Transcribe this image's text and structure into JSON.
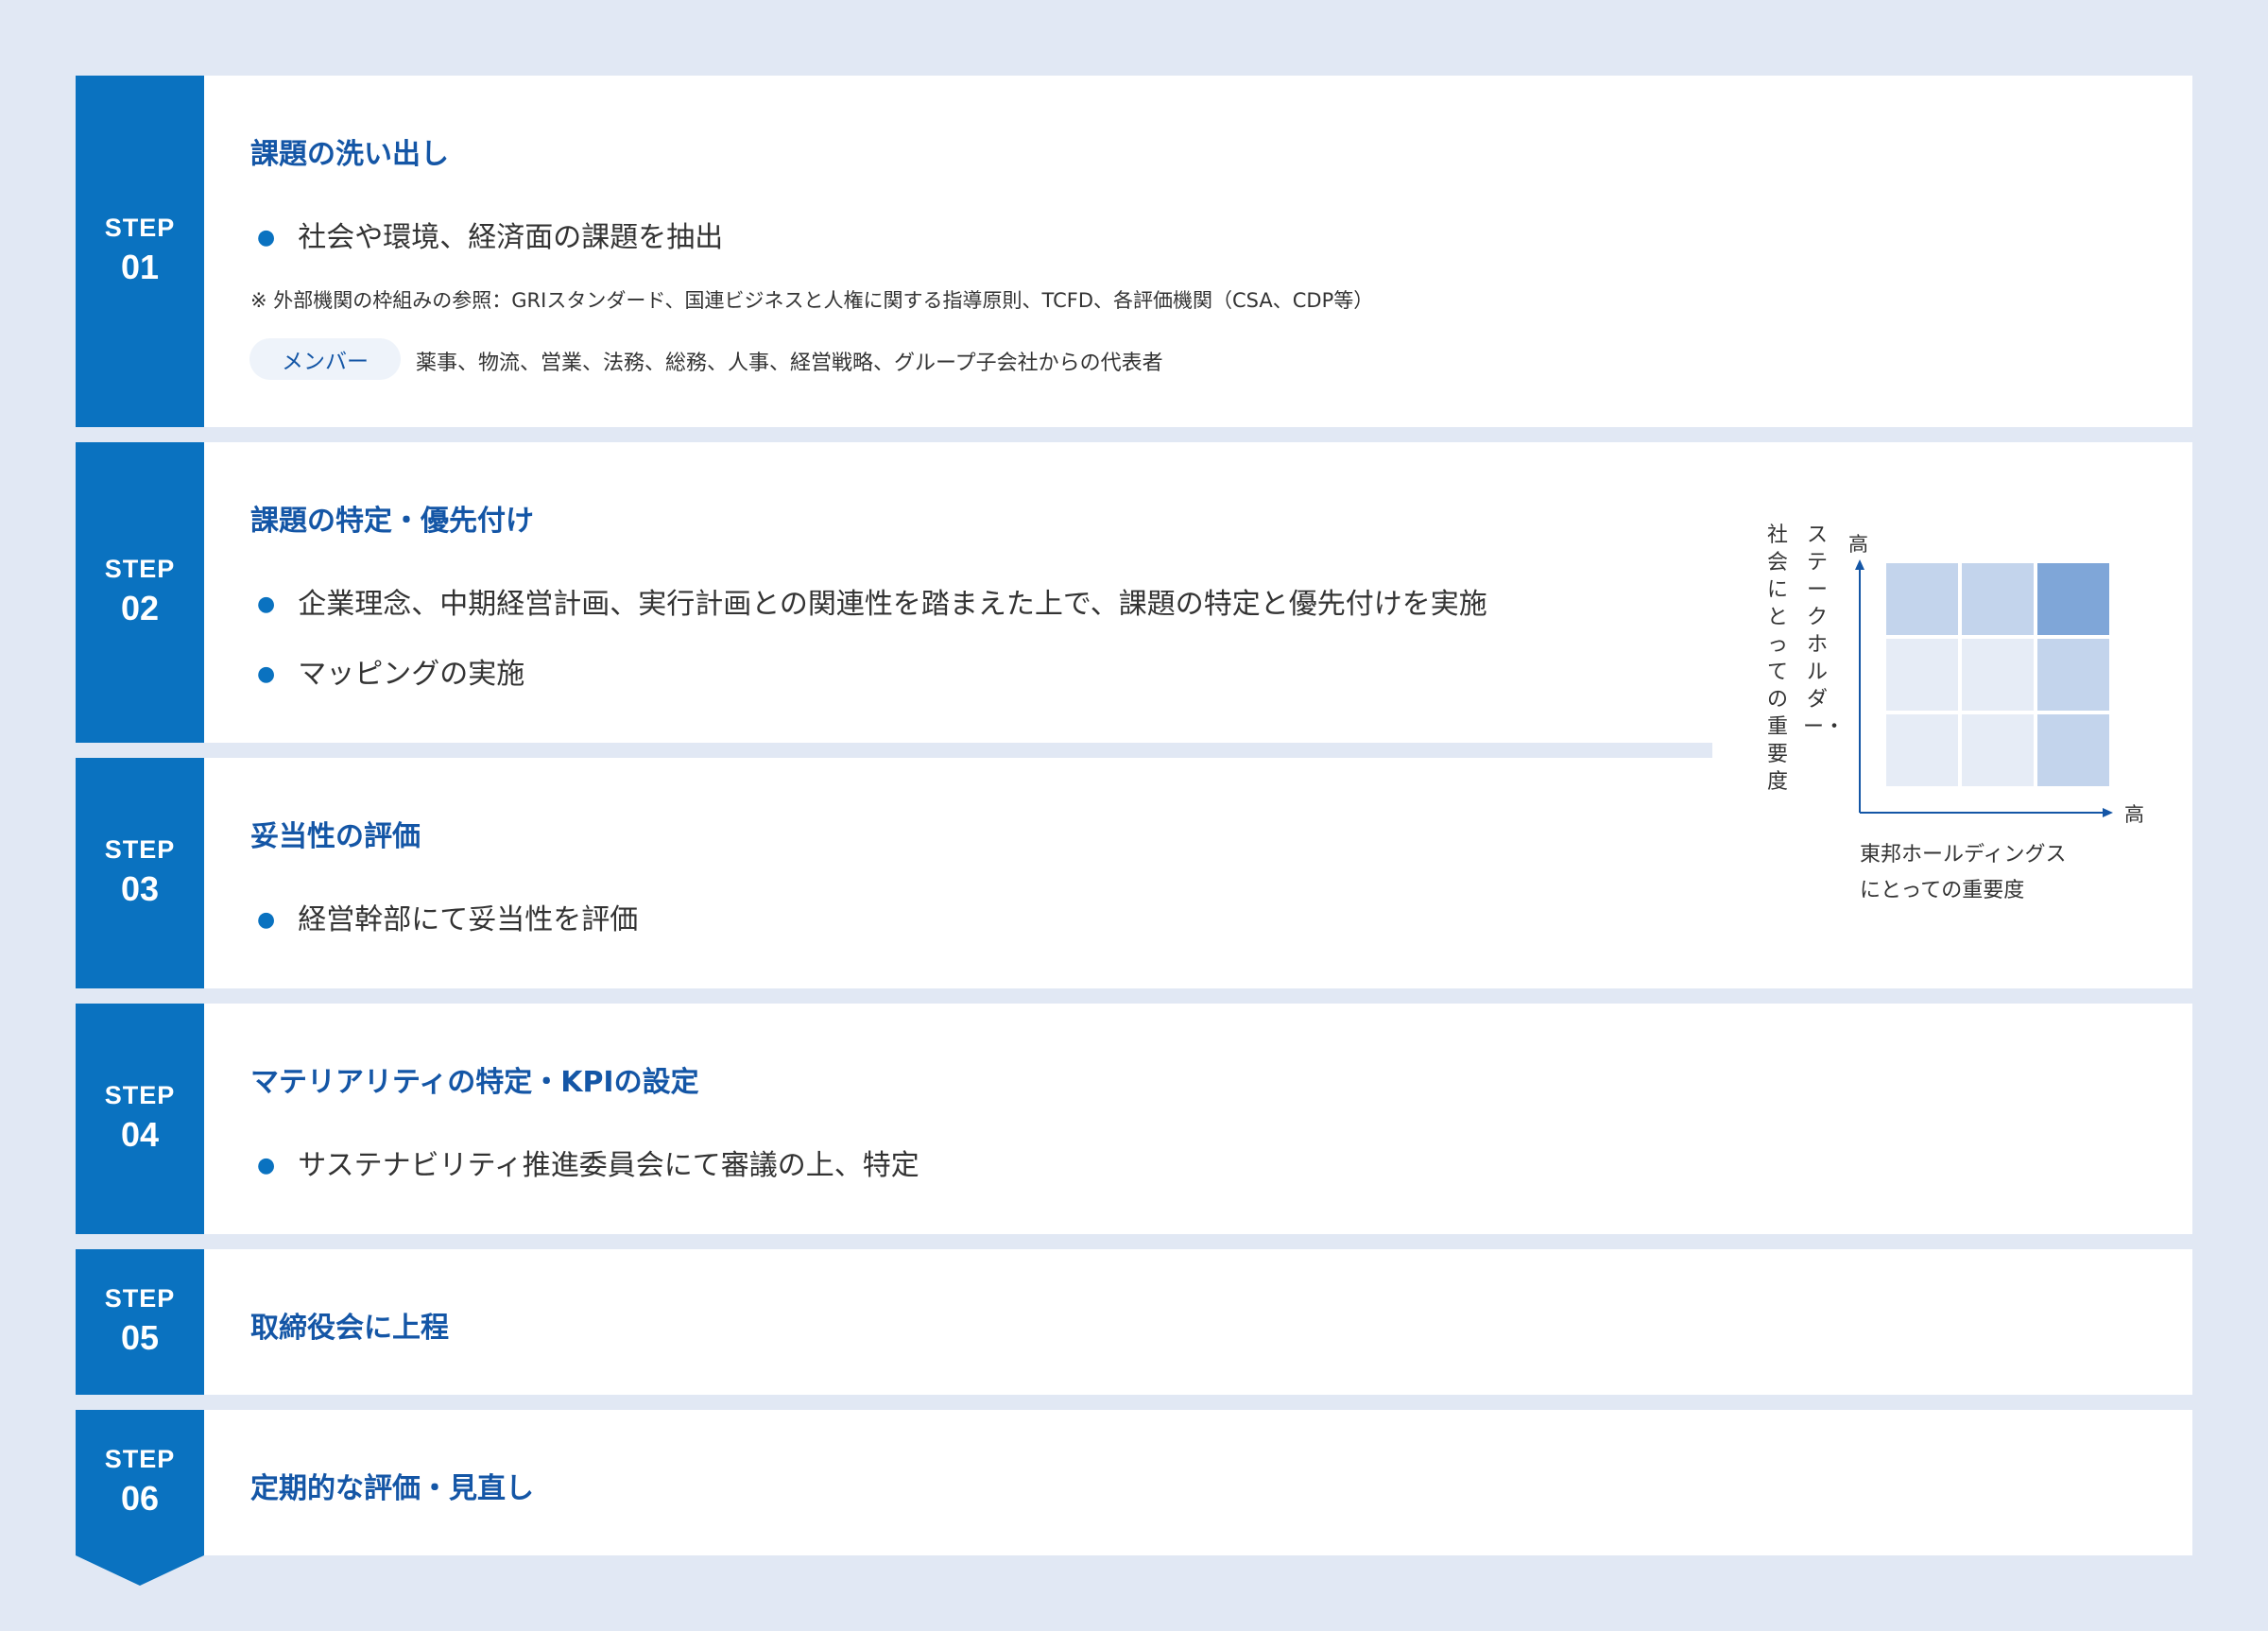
{
  "steps": [
    {
      "label": "STEP",
      "number": "01",
      "title": "課題の洗い出し",
      "bullets": [
        "社会や環境、経済面の課題を抽出"
      ],
      "note": "※ 外部機関の枠組みの参照：GRIスタンダード、国連ビジネスと人権に関する指導原則、TCFD、各評価機関（CSA、CDP等）",
      "member_label": "メンバー",
      "members": "薬事、物流、営業、法務、総務、人事、経営戦略、グループ子会社からの代表者"
    },
    {
      "label": "STEP",
      "number": "02",
      "title": "課題の特定・優先付け",
      "bullets": [
        "企業理念、中期経営計画、実行計画との関連性を踏まえた上で、課題の特定と優先付けを実施",
        "マッピングの実施"
      ]
    },
    {
      "label": "STEP",
      "number": "03",
      "title": "妥当性の評価",
      "bullets": [
        "経営幹部にて妥当性を評価"
      ]
    },
    {
      "label": "STEP",
      "number": "04",
      "title": "マテリアリティの特定・KPIの設定",
      "bullets": [
        "サステナビリティ推進委員会にて審議の上、特定"
      ]
    },
    {
      "label": "STEP",
      "number": "05",
      "title": "取締役会に上程"
    },
    {
      "label": "STEP",
      "number": "06",
      "title": "定期的な評価・見直し"
    }
  ],
  "matrix": {
    "y_label_line1": "ステークホルダー・",
    "y_label_line2": "社会にとっての重要度",
    "y_high": "高",
    "x_high": "高",
    "x_label_line1": "東邦ホールディングス",
    "x_label_line2": "にとっての重要度",
    "cells": [
      [
        "#c3d4ec",
        "#c3d4ec",
        "#7fa6d8"
      ],
      [
        "#e6ecf6",
        "#e6ecf6",
        "#c3d4ec"
      ],
      [
        "#e6ecf6",
        "#e6ecf6",
        "#c3d4ec"
      ]
    ],
    "axis_color": "#1456a6"
  }
}
